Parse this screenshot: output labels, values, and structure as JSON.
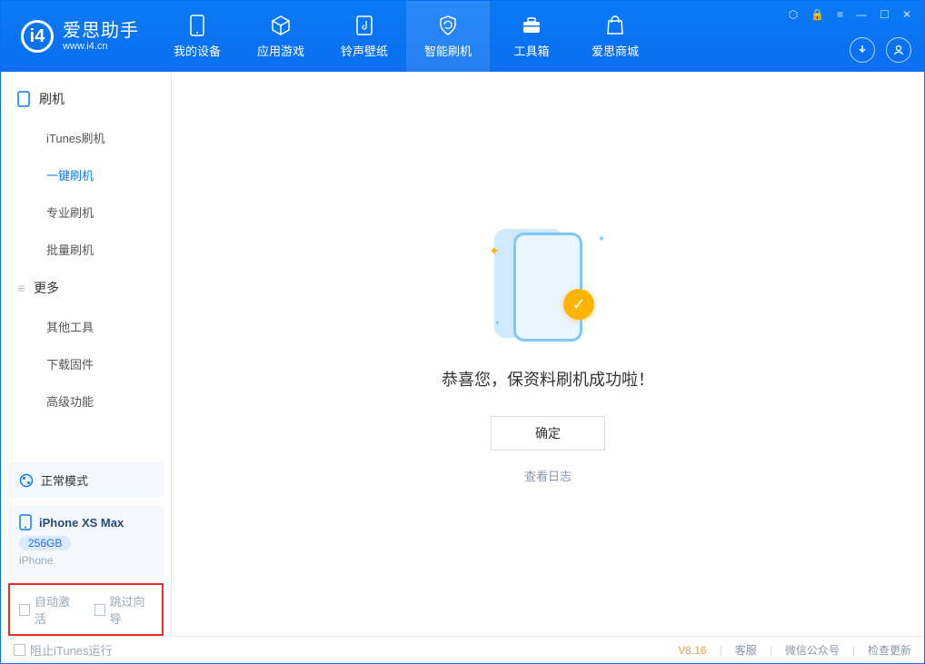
{
  "app": {
    "title": "爱思助手",
    "subtitle": "www.i4.cn"
  },
  "nav": {
    "items": [
      {
        "label": "我的设备"
      },
      {
        "label": "应用游戏"
      },
      {
        "label": "铃声壁纸"
      },
      {
        "label": "智能刷机"
      },
      {
        "label": "工具箱"
      },
      {
        "label": "爱思商城"
      }
    ]
  },
  "sidebar": {
    "group1": {
      "title": "刷机",
      "items": [
        "iTunes刷机",
        "一键刷机",
        "专业刷机",
        "批量刷机"
      ]
    },
    "group2": {
      "title": "更多",
      "items": [
        "其他工具",
        "下载固件",
        "高级功能"
      ]
    },
    "mode_card": {
      "label": "正常模式"
    },
    "device_card": {
      "name": "iPhone XS Max",
      "storage": "256GB",
      "type": "iPhone"
    },
    "options": {
      "auto_activate": "自动激活",
      "skip_guide": "跳过向导"
    }
  },
  "main": {
    "success_text": "恭喜您，保资料刷机成功啦！",
    "ok_button": "确定",
    "view_log": "查看日志"
  },
  "statusbar": {
    "block_itunes": "阻止iTunes运行",
    "version": "V8.16",
    "support": "客服",
    "wechat": "微信公众号",
    "update": "检查更新"
  }
}
